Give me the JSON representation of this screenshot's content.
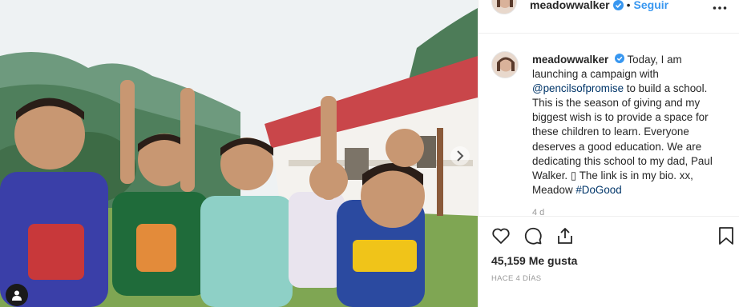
{
  "post": {
    "image_alt": "Children raising peace signs in front of a school building",
    "author": {
      "username": "meadowwalker",
      "verified": true
    },
    "header": {
      "separator": "•",
      "follow_label": "Seguir"
    },
    "caption": {
      "username": "meadowwalker",
      "text_1": "Today, I am launching a campaign with ",
      "mention": "@pencilsofpromise",
      "text_2": " to build a school. This is the season of giving and my biggest wish is to provide a space for these children to learn. Everyone deserves a good education. We are dedicating this school to my dad, Paul Walker. ",
      "emoji": "▯",
      "text_3": " The link is in my bio. xx, Meadow ",
      "hashtag": "#DoGood",
      "time": "4 d"
    },
    "likes_label": "45,159 Me gusta",
    "timestamp": "HACE 4 DÍAS"
  },
  "colors": {
    "link_blue": "#3897f0",
    "mention_blue": "#003569",
    "verified_blue": "#3897f0",
    "text": "#262626",
    "muted": "#999999"
  },
  "icons": [
    "heart-icon",
    "comment-icon",
    "share-icon",
    "bookmark-icon",
    "more-icon",
    "chevron-right-icon",
    "user-tag-icon",
    "verified-badge-icon"
  ]
}
